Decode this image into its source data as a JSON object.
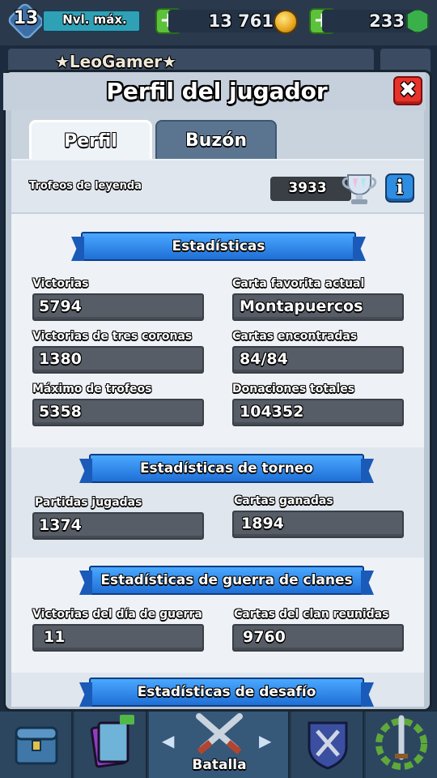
{
  "hud": {
    "level": "13",
    "level_label": "Nvl. máx.",
    "gold": "13 761",
    "gems": "233",
    "plus_symbol": "+"
  },
  "player": {
    "name": "★LeoGamer★"
  },
  "modal": {
    "title": "Perfil del jugador",
    "close_symbol": "✖",
    "tabs": [
      {
        "label": "Perfil",
        "active": true
      },
      {
        "label": "Buzón",
        "active": false
      }
    ],
    "legend_trophies": {
      "label": "Trofeos de leyenda",
      "value": "3933",
      "info_symbol": "i"
    }
  },
  "sections": {
    "stats": {
      "title": "Estadísticas",
      "items": [
        {
          "label": "Victorias",
          "value": "5794"
        },
        {
          "label": "Carta favorita actual",
          "value": "Montapuercos"
        },
        {
          "label": "Victorias de tres coronas",
          "value": "1380"
        },
        {
          "label": "Cartas encontradas",
          "value": "84/84"
        },
        {
          "label": "Máximo de trofeos",
          "value": "5358"
        },
        {
          "label": "Donaciones totales",
          "value": "104352"
        }
      ]
    },
    "tournament": {
      "title": "Estadísticas de torneo",
      "items": [
        {
          "label": "Partidas jugadas",
          "value": "1374"
        },
        {
          "label": "Cartas ganadas",
          "value": "1894"
        }
      ]
    },
    "clan_war": {
      "title": "Estadísticas de guerra de clanes",
      "items": [
        {
          "label": "Victorias del día de guerra",
          "value": "11"
        },
        {
          "label": "Cartas del clan reunidas",
          "value": "9760"
        }
      ]
    },
    "challenge": {
      "title": "Estadísticas de desafío"
    }
  },
  "nav": {
    "battle_label": "Batalla",
    "left_arrow": "◀",
    "right_arrow": "▶"
  },
  "colors": {
    "banner_blue": "#1f6fd6",
    "close_red": "#e8322c",
    "info_blue": "#2e8de0",
    "stat_box": "#575d66"
  }
}
